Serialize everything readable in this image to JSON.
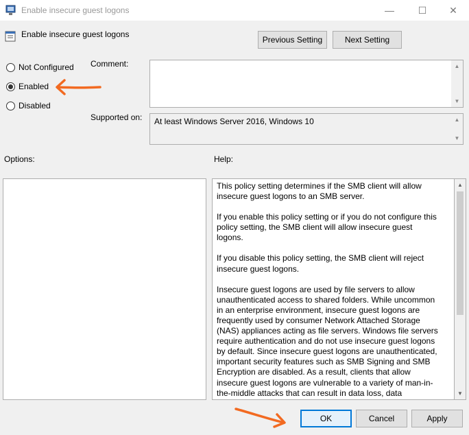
{
  "window": {
    "title": "Enable insecure guest logons",
    "minimize_glyph": "—",
    "maximize_glyph": "☐",
    "close_glyph": "✕"
  },
  "header": {
    "policy_title": "Enable insecure guest logons",
    "prev_label": "Previous Setting",
    "next_label": "Next Setting"
  },
  "state": {
    "options": [
      "Not Configured",
      "Enabled",
      "Disabled"
    ],
    "selected": "Enabled"
  },
  "comment": {
    "label": "Comment:",
    "value": ""
  },
  "supported": {
    "label": "Supported on:",
    "value": "At least Windows Server 2016, Windows 10"
  },
  "options_panel": {
    "label": "Options:"
  },
  "help_panel": {
    "label": "Help:",
    "paragraphs": [
      "This policy setting determines if the SMB client will allow insecure guest logons to an SMB server.",
      "If you enable this policy setting or if you do not configure this policy setting, the SMB client will allow insecure guest logons.",
      "If you disable this policy setting, the SMB client will reject insecure guest logons.",
      "Insecure guest logons are used by file servers to allow unauthenticated access to shared folders. While uncommon in an enterprise environment, insecure guest logons are frequently used by consumer Network Attached Storage (NAS) appliances acting as file servers. Windows file servers require authentication and do not use insecure guest logons by default. Since insecure guest logons are unauthenticated, important security features such as SMB Signing and SMB Encryption are disabled. As a result, clients that allow insecure guest logons are vulnerable to a variety of man-in-the-middle attacks that can result in data loss, data corruption, and exposure to malware. Additionally, any data written to a file server using an insecure guest logon is"
    ]
  },
  "footer": {
    "ok_label": "OK",
    "cancel_label": "Cancel",
    "apply_label": "Apply"
  },
  "colors": {
    "annotation_arrow": "#f26a21",
    "ok_focus": "#0078d7"
  },
  "icons": {
    "app": "group-policy-icon",
    "policy": "policy-setting-icon"
  }
}
